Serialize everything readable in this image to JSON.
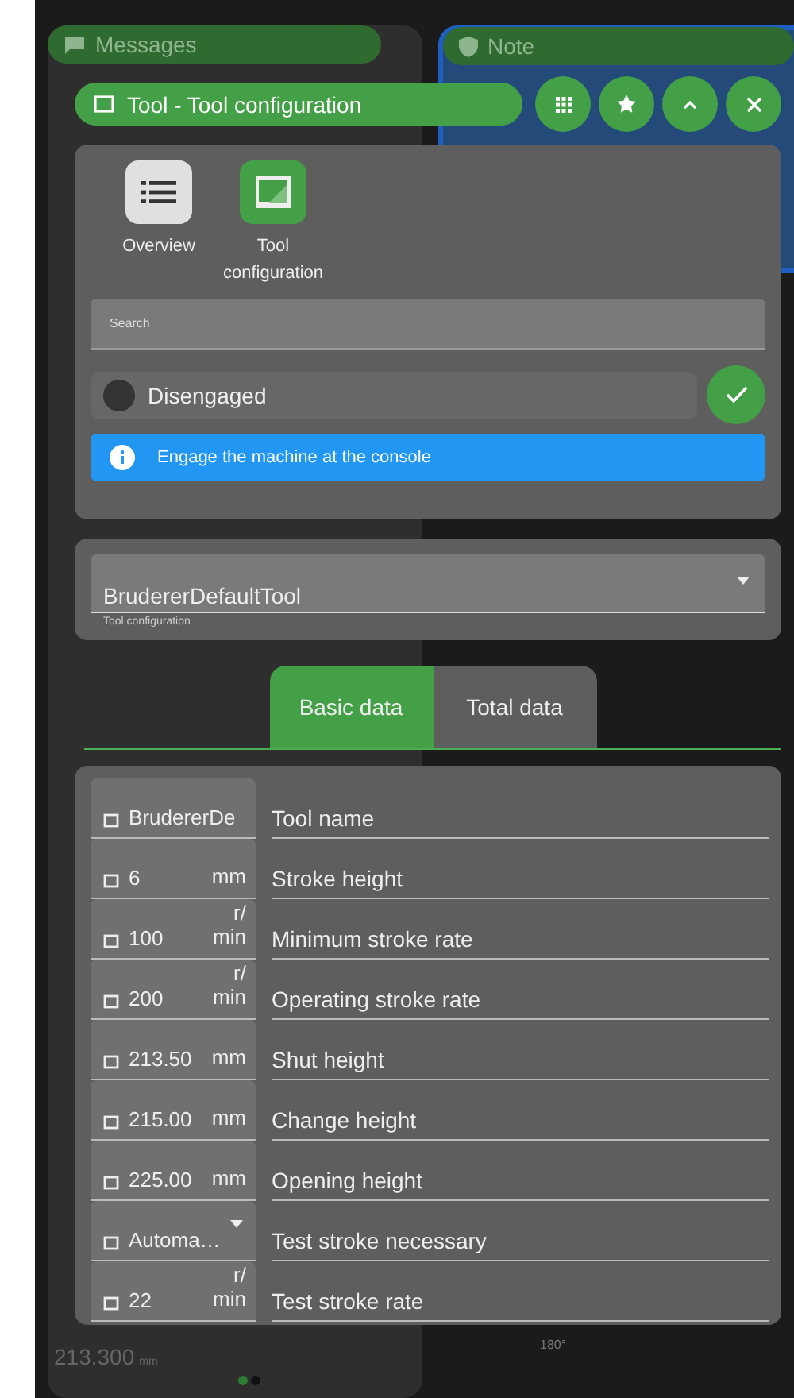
{
  "background": {
    "messages_title": "Messages",
    "note_title": "Note",
    "reading": "213.300",
    "reading_unit": "mm",
    "angle": "180°",
    "page_dots": [
      {
        "selected": true
      },
      {
        "selected": false
      }
    ]
  },
  "window": {
    "title": "Tool - Tool configuration"
  },
  "apps": [
    {
      "label": "Overview",
      "selected": false
    },
    {
      "label": "Tool configuration",
      "selected": true
    }
  ],
  "search": {
    "placeholder": "Search"
  },
  "machine": {
    "state": "Disengaged",
    "engaged": false
  },
  "info": "Engage the machine at the console",
  "tool_select": {
    "value": "BrudererDefaultTool",
    "label": "Tool configuration"
  },
  "tabs": [
    {
      "label": "Basic data",
      "selected": true
    },
    {
      "label": "Total data",
      "selected": false
    }
  ],
  "parameters": [
    {
      "kind": "text",
      "value": "BrudererDe",
      "label": "Tool name"
    },
    {
      "kind": "number",
      "value": "6",
      "unit": "mm",
      "label": "Stroke height"
    },
    {
      "kind": "number",
      "value": "100",
      "unit": "r/ min",
      "label": "Minimum stroke rate"
    },
    {
      "kind": "number",
      "value": "200",
      "unit": "r/ min",
      "label": "Operating stroke rate"
    },
    {
      "kind": "number",
      "value": "213.50",
      "unit": "mm",
      "label": "Shut height"
    },
    {
      "kind": "number",
      "value": "215.00",
      "unit": "mm",
      "label": "Change height"
    },
    {
      "kind": "number",
      "value": "225.00",
      "unit": "mm",
      "label": "Opening height"
    },
    {
      "kind": "select",
      "value": "Automa…",
      "label": "Test stroke necessary"
    },
    {
      "kind": "number",
      "value": "22",
      "unit": "r/ min",
      "label": "Test stroke rate"
    }
  ]
}
